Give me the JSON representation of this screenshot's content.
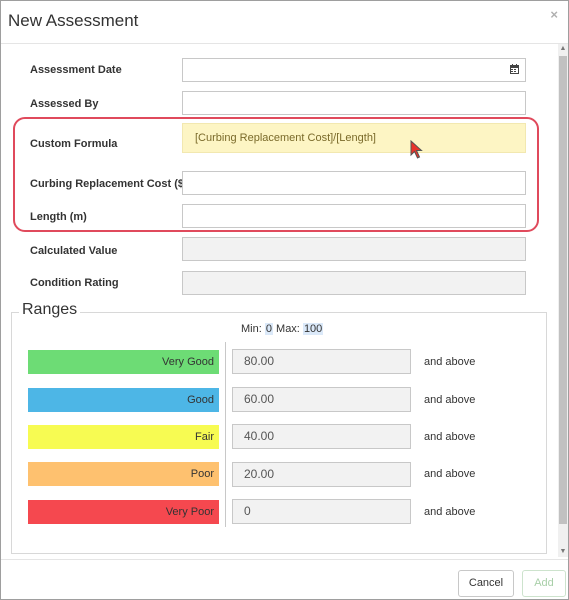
{
  "dialog": {
    "title": "New Assessment",
    "close_glyph": "×"
  },
  "form": {
    "assessment_date": {
      "label": "Assessment Date",
      "value": ""
    },
    "assessed_by": {
      "label": "Assessed By",
      "value": ""
    },
    "custom_formula": {
      "label": "Custom Formula",
      "value": "[Curbing Replacement Cost]/[Length]"
    },
    "curbing_cost": {
      "label": "Curbing Replacement Cost ($)",
      "value": ""
    },
    "length": {
      "label": "Length (m)",
      "value": ""
    },
    "calculated_value": {
      "label": "Calculated Value",
      "value": ""
    },
    "condition_rating": {
      "label": "Condition Rating",
      "value": ""
    }
  },
  "ranges": {
    "title": "Ranges",
    "min_label": "Min:",
    "min_value": "0",
    "max_label": "Max:",
    "max_value": "100",
    "rows": [
      {
        "name": "Very Good",
        "value": "80.00",
        "suffix": "and above",
        "color": "#6ddc75"
      },
      {
        "name": "Good",
        "value": "60.00",
        "suffix": "and above",
        "color": "#4db6e6"
      },
      {
        "name": "Fair",
        "value": "40.00",
        "suffix": "and above",
        "color": "#f7fb52"
      },
      {
        "name": "Poor",
        "value": "20.00",
        "suffix": "and above",
        "color": "#fec16f"
      },
      {
        "name": "Very Poor",
        "value": "0",
        "suffix": "and above",
        "color": "#f5484f"
      }
    ]
  },
  "footer": {
    "cancel_label": "Cancel",
    "add_label": "Add"
  },
  "colors": {
    "highlight": "#e04a5c",
    "formula_bg": "#fdf5c4",
    "cursor": "#e8332a"
  }
}
